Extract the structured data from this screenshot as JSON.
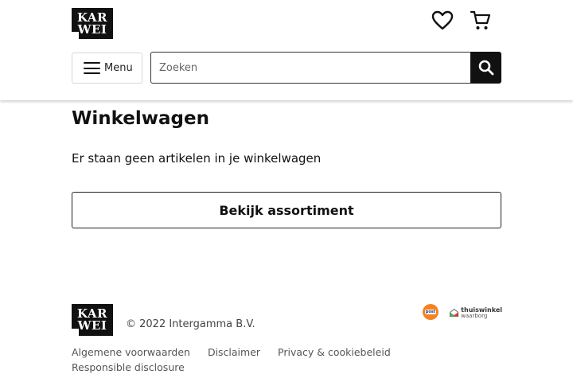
{
  "header": {
    "logo_line1": "KAR",
    "logo_line2": "WEI",
    "icons": {
      "favorites": "heart-icon",
      "cart": "shopping-cart-icon",
      "menu": "hamburger-icon",
      "search": "search-icon"
    },
    "menu_label": "Menu",
    "search": {
      "placeholder": "Zoeken",
      "value": ""
    }
  },
  "main": {
    "title": "Winkelwagen",
    "empty_message": "Er staan geen artikelen in je winkelwagen",
    "cta_label": "Bekijk assortiment"
  },
  "footer": {
    "logo_line1": "KAR",
    "logo_line2": "WEI",
    "copyright": "© 2022 Intergamma B.V.",
    "links": [
      "Algemene voorwaarden",
      "Disclaimer",
      "Privacy & cookiebeleid",
      "Responsible disclosure"
    ],
    "badges": {
      "postnl_label": "post",
      "thuiswinkel_line1": "thuiswinkel",
      "thuiswinkel_line2": "waarborg"
    }
  },
  "colors": {
    "black": "#111111",
    "postnl_orange": "#f58220"
  }
}
